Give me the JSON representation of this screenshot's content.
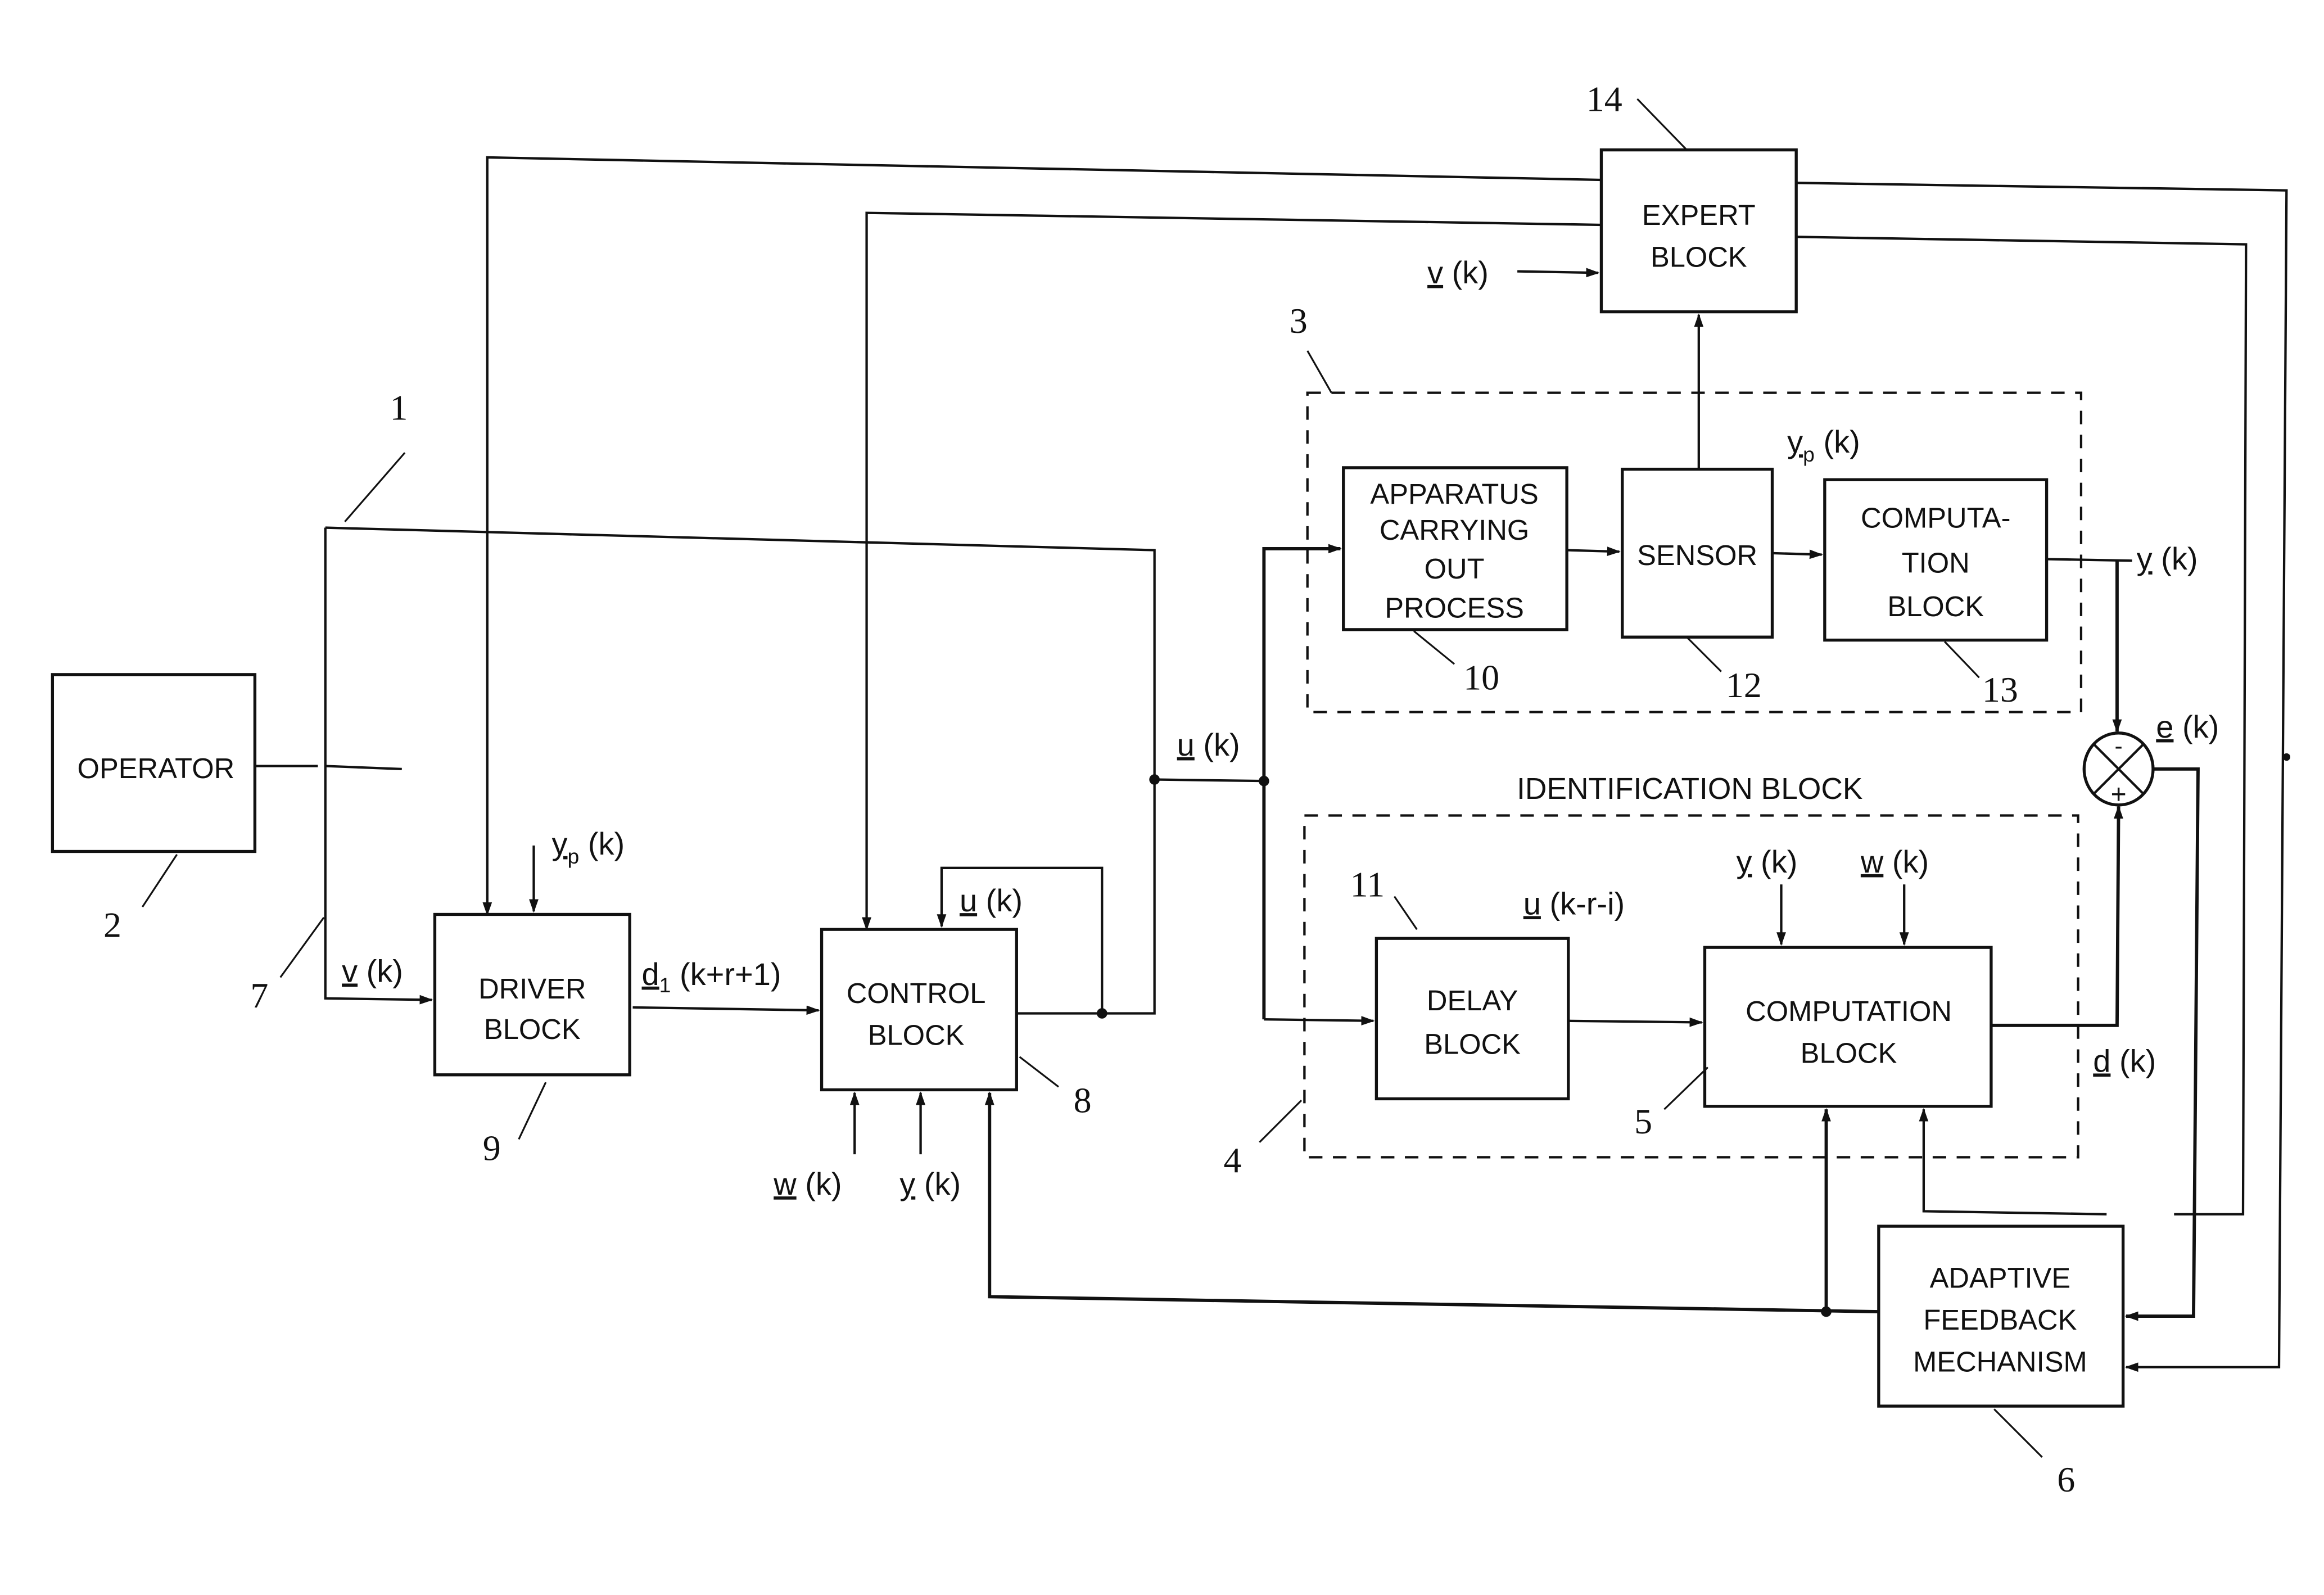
{
  "figure": {
    "blocks": {
      "operator": {
        "lines": [
          "OPERATOR"
        ],
        "ref": "2"
      },
      "driver": {
        "lines": [
          "DRIVER",
          "BLOCK"
        ],
        "ref": "9"
      },
      "control": {
        "lines": [
          "CONTROL",
          "BLOCK"
        ],
        "ref": "8"
      },
      "expert": {
        "lines": [
          "EXPERT",
          "BLOCK"
        ],
        "ref": "14"
      },
      "apparatus": {
        "lines": [
          "APPARATUS",
          "CARRYING",
          "OUT",
          "PROCESS"
        ],
        "ref": "10"
      },
      "sensor": {
        "lines": [
          "SENSOR"
        ],
        "ref": "12"
      },
      "computation_process": {
        "lines": [
          "COMPUTA-",
          "TION",
          "BLOCK"
        ],
        "ref": "13"
      },
      "delay": {
        "lines": [
          "DELAY",
          "BLOCK"
        ],
        "ref": "11"
      },
      "computation_ident": {
        "lines": [
          "COMPUTATION",
          "BLOCK"
        ],
        "ref": "5"
      },
      "adaptive": {
        "lines": [
          "ADAPTIVE",
          "FEEDBACK",
          "MECHANISM"
        ],
        "ref": "6"
      }
    },
    "groups": {
      "process_group": {
        "ref": "3"
      },
      "identification_group": {
        "title": "IDENTIFICATION BLOCK",
        "ref": "4"
      }
    },
    "bus_refs": {
      "top_bus": "1",
      "operator_line": "7"
    },
    "signals": {
      "v_driver": {
        "sym": "v",
        "arg": " (k)"
      },
      "yp_driver": {
        "sym": "y",
        "sub": "p",
        "arg": " (k)"
      },
      "d1": {
        "sym": "d",
        "sub": "1",
        "arg": " (k+r+1)"
      },
      "u_feedback": {
        "sym": "u",
        "arg": " (k)"
      },
      "w_control": {
        "sym": "w",
        "arg": " (k)"
      },
      "y_control": {
        "sym": "y",
        "arg": " (k)"
      },
      "u_main": {
        "sym": "u",
        "arg": " (k)"
      },
      "v_expert": {
        "sym": "v",
        "arg": " (k)"
      },
      "yp_sensor": {
        "sym": "y",
        "sub": "p",
        "arg": " (k)"
      },
      "y_out": {
        "sym": "y",
        "arg": " (k)"
      },
      "e": {
        "sym": "e",
        "arg": " (k)"
      },
      "u_delay": {
        "sym": "u",
        "arg": " (k-r-i)"
      },
      "y_ident": {
        "sym": "y",
        "arg": " (k)"
      },
      "w_ident": {
        "sym": "w",
        "arg": " (k)"
      },
      "d": {
        "sym": "d",
        "arg": " (k)"
      }
    },
    "summing_junction": {
      "minus": "-",
      "plus": "+"
    }
  }
}
